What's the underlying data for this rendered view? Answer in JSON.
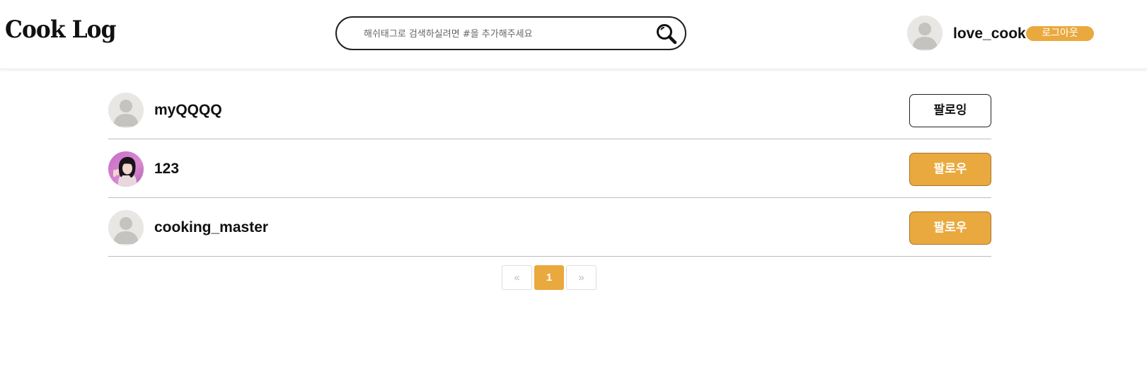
{
  "header": {
    "logo": "Cook Log",
    "search": {
      "placeholder": "해쉬태그로 검색하실려면 #을 추가해주세요",
      "value": ""
    },
    "user": {
      "username": "love_cook",
      "logout_label": "로그아웃"
    }
  },
  "users": [
    {
      "name": "myQQQQ",
      "avatar": "default-avatar",
      "button_label": "팔로잉",
      "following": true
    },
    {
      "name": "123",
      "avatar": "photo-avatar",
      "button_label": "팔로우",
      "following": false
    },
    {
      "name": "cooking_master",
      "avatar": "default-avatar",
      "button_label": "팔로우",
      "following": false
    }
  ],
  "pagination": {
    "prev": "«",
    "current": "1",
    "next": "»"
  },
  "colors": {
    "accent": "#eaa93e",
    "divider": "#bdbdbd",
    "avatar_bg": "#e8e7e3"
  },
  "icons": {
    "search": "magnifier-icon",
    "avatar": "person-silhouette-icon"
  }
}
